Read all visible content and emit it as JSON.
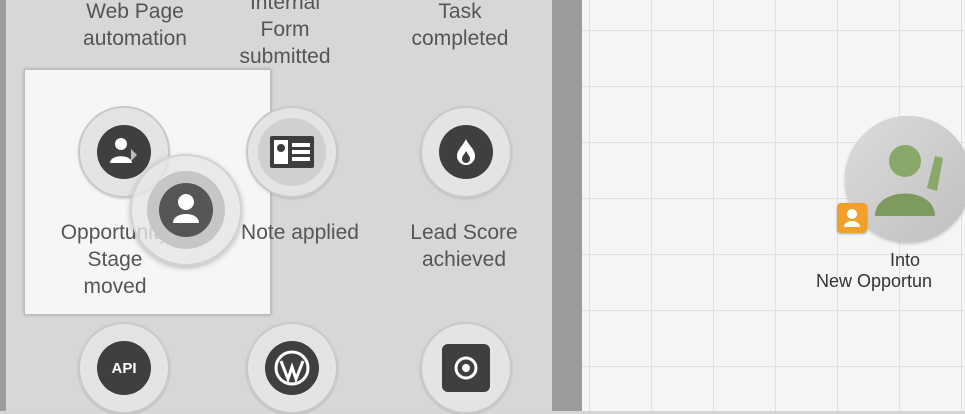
{
  "palette": {
    "row0": [
      {
        "label_lines": [
          "Web Page",
          "automation"
        ]
      },
      {
        "label_lines": [
          "Internal",
          "Form",
          "submitted"
        ]
      },
      {
        "label_lines": [
          "Task",
          "completed"
        ]
      }
    ],
    "row1": [
      {
        "label_lines": [
          "Opportunity",
          "Stage",
          "moved"
        ],
        "icon": "opportunity-stage-icon",
        "selected": true
      },
      {
        "label_lines": [
          "Note applied"
        ],
        "icon": "note-card-icon"
      },
      {
        "label_lines": [
          "Lead Score",
          "achieved"
        ],
        "icon": "flame-icon"
      }
    ],
    "row2": [
      {
        "icon": "api-icon",
        "icon_text": "API"
      },
      {
        "icon": "wordpress-icon"
      },
      {
        "icon": "target-icon"
      }
    ]
  },
  "canvas": {
    "node": {
      "icon": "person-waving-icon",
      "label_lines": [
        "Into",
        "New Opportun"
      ],
      "badge_icon": "contact-badge-icon",
      "badge_color": "#f1a12a"
    }
  },
  "colors": {
    "panel_bg": "#d7d7d7",
    "canvas_bg": "#f5f5f5",
    "divider": "#9b9b9b",
    "dark_icon": "#3f3f3f"
  }
}
